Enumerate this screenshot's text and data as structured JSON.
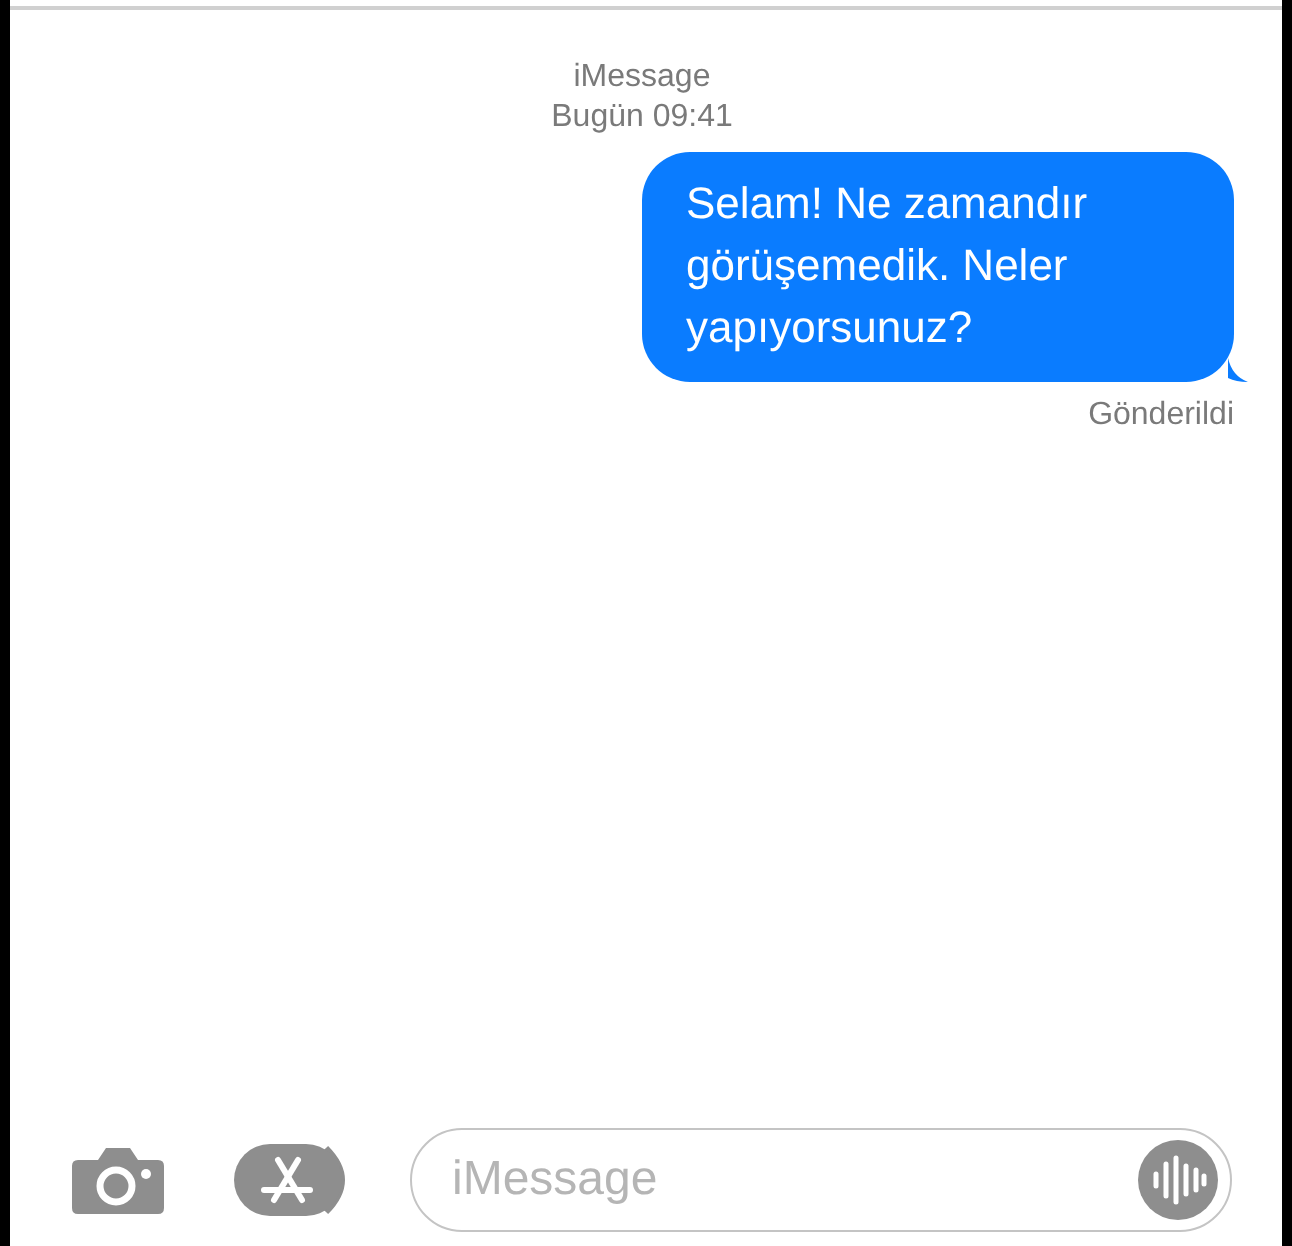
{
  "header": {
    "service": "iMessage",
    "time": "Bugün 09:41"
  },
  "messages": [
    {
      "text": "Selam! Ne zamandır görüşemedik. Neler yapıyorsunuz?",
      "outgoing": true
    }
  ],
  "delivery_status": "Gönderildi",
  "composer": {
    "placeholder": "iMessage"
  }
}
